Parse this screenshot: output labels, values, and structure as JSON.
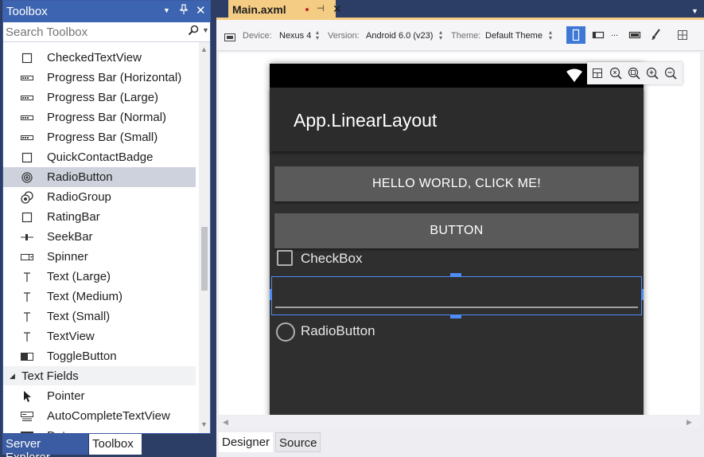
{
  "toolbox": {
    "title": "Toolbox",
    "search_placeholder": "Search Toolbox",
    "items": [
      {
        "label": "CheckedTextView",
        "icon": "checkbox-icon"
      },
      {
        "label": "Progress Bar (Horizontal)",
        "icon": "progress-bar-icon"
      },
      {
        "label": "Progress Bar (Large)",
        "icon": "progress-bar-icon"
      },
      {
        "label": "Progress Bar (Normal)",
        "icon": "progress-bar-icon"
      },
      {
        "label": "Progress Bar (Small)",
        "icon": "progress-bar-icon"
      },
      {
        "label": "QuickContactBadge",
        "icon": "checkbox-icon"
      },
      {
        "label": "RadioButton",
        "icon": "radio-button-icon",
        "selected": true
      },
      {
        "label": "RadioGroup",
        "icon": "radio-group-icon"
      },
      {
        "label": "RatingBar",
        "icon": "checkbox-icon"
      },
      {
        "label": "SeekBar",
        "icon": "seekbar-icon"
      },
      {
        "label": "Spinner",
        "icon": "spinner-icon"
      },
      {
        "label": "Text (Large)",
        "icon": "text-icon"
      },
      {
        "label": "Text (Medium)",
        "icon": "text-icon"
      },
      {
        "label": "Text (Small)",
        "icon": "text-icon"
      },
      {
        "label": "TextView",
        "icon": "text-icon"
      },
      {
        "label": "ToggleButton",
        "icon": "toggle-button-icon"
      }
    ],
    "category": "Text Fields",
    "category_items": [
      {
        "label": "Pointer",
        "icon": "pointer-icon"
      },
      {
        "label": "AutoCompleteTextView",
        "icon": "autocomplete-icon"
      },
      {
        "label": "Date",
        "icon": "date-icon"
      }
    ]
  },
  "bottom_tabs": {
    "server_explorer": "Server Explorer",
    "toolbox": "Toolbox"
  },
  "document": {
    "tab_name": "Main.axml"
  },
  "designer_toolbar": {
    "device_label": "Device:",
    "device_value": "Nexus 4",
    "version_label": "Version:",
    "version_value": "Android 6.0 (v23)",
    "theme_label": "Theme:",
    "theme_value": "Default Theme",
    "more": "..."
  },
  "phone": {
    "app_title": "App.LinearLayout",
    "button1": "HELLO WORLD, CLICK ME!",
    "button2": "BUTTON",
    "checkbox": "CheckBox",
    "radio": "RadioButton"
  },
  "view_tabs": {
    "designer": "Designer",
    "source": "Source"
  },
  "colors": {
    "accent": "#3d64b0",
    "tab_active": "#f5cc84",
    "selection": "#4d8bf5",
    "phone_bg": "#2f2f2f"
  }
}
